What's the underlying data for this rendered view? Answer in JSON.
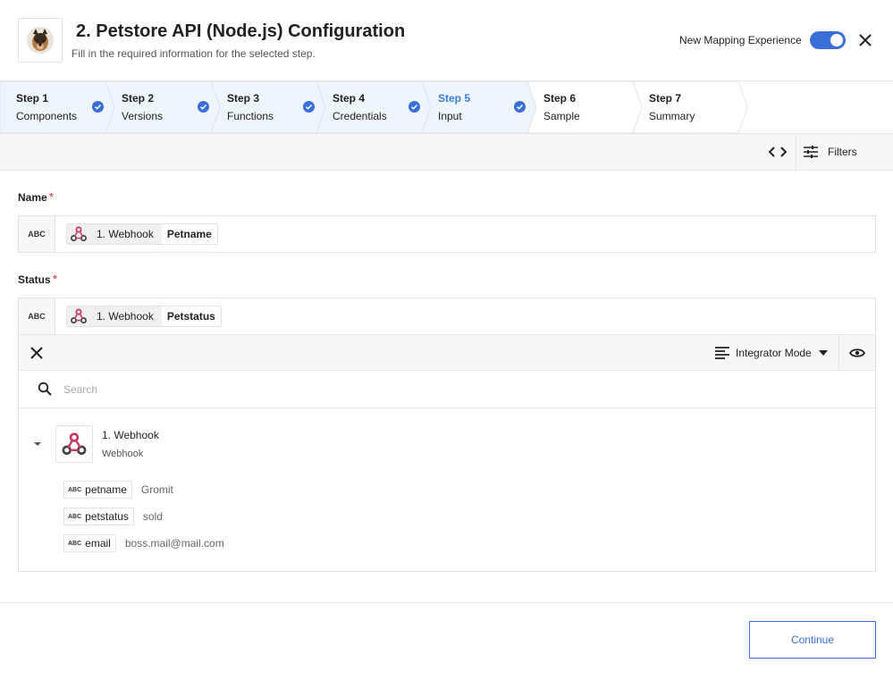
{
  "header": {
    "title": "2. Petstore API (Node.js) Configuration",
    "subtitle": "Fill in the required information for the selected step.",
    "mapping_label": "New Mapping Experience",
    "mapping_enabled": true
  },
  "steps": [
    {
      "title": "Step 1",
      "label": "Components",
      "status": "complete"
    },
    {
      "title": "Step 2",
      "label": "Versions",
      "status": "complete"
    },
    {
      "title": "Step 3",
      "label": "Functions",
      "status": "complete"
    },
    {
      "title": "Step 4",
      "label": "Credentials",
      "status": "complete"
    },
    {
      "title": "Step 5",
      "label": "Input",
      "status": "active-complete"
    },
    {
      "title": "Step 6",
      "label": "Sample",
      "status": "pending"
    },
    {
      "title": "Step 7",
      "label": "Summary",
      "status": "pending"
    }
  ],
  "toolbar": {
    "filters_label": "Filters"
  },
  "fields": {
    "name": {
      "label": "Name",
      "required_mark": "*",
      "type": "ABC",
      "source": "1. Webhook",
      "value": "Petname"
    },
    "status": {
      "label": "Status",
      "required_mark": "*",
      "type": "ABC",
      "source": "1. Webhook",
      "value": "Petstatus"
    }
  },
  "panel": {
    "mode_label": "Integrator Mode",
    "search_placeholder": "Search",
    "source": {
      "title": "1. Webhook",
      "subtitle": "Webhook"
    },
    "items": [
      {
        "type": "ABC",
        "name": "petname",
        "value": "Gromit"
      },
      {
        "type": "ABC",
        "name": "petstatus",
        "value": "sold"
      },
      {
        "type": "ABC",
        "name": "email",
        "value": "boss.mail@mail.com"
      }
    ]
  },
  "footer": {
    "continue_label": "Continue"
  },
  "colors": {
    "accent": "#3a6fd8",
    "step_done_bg": "#eef5fd",
    "required": "#e03a3a",
    "webhook": "#c73a63"
  }
}
